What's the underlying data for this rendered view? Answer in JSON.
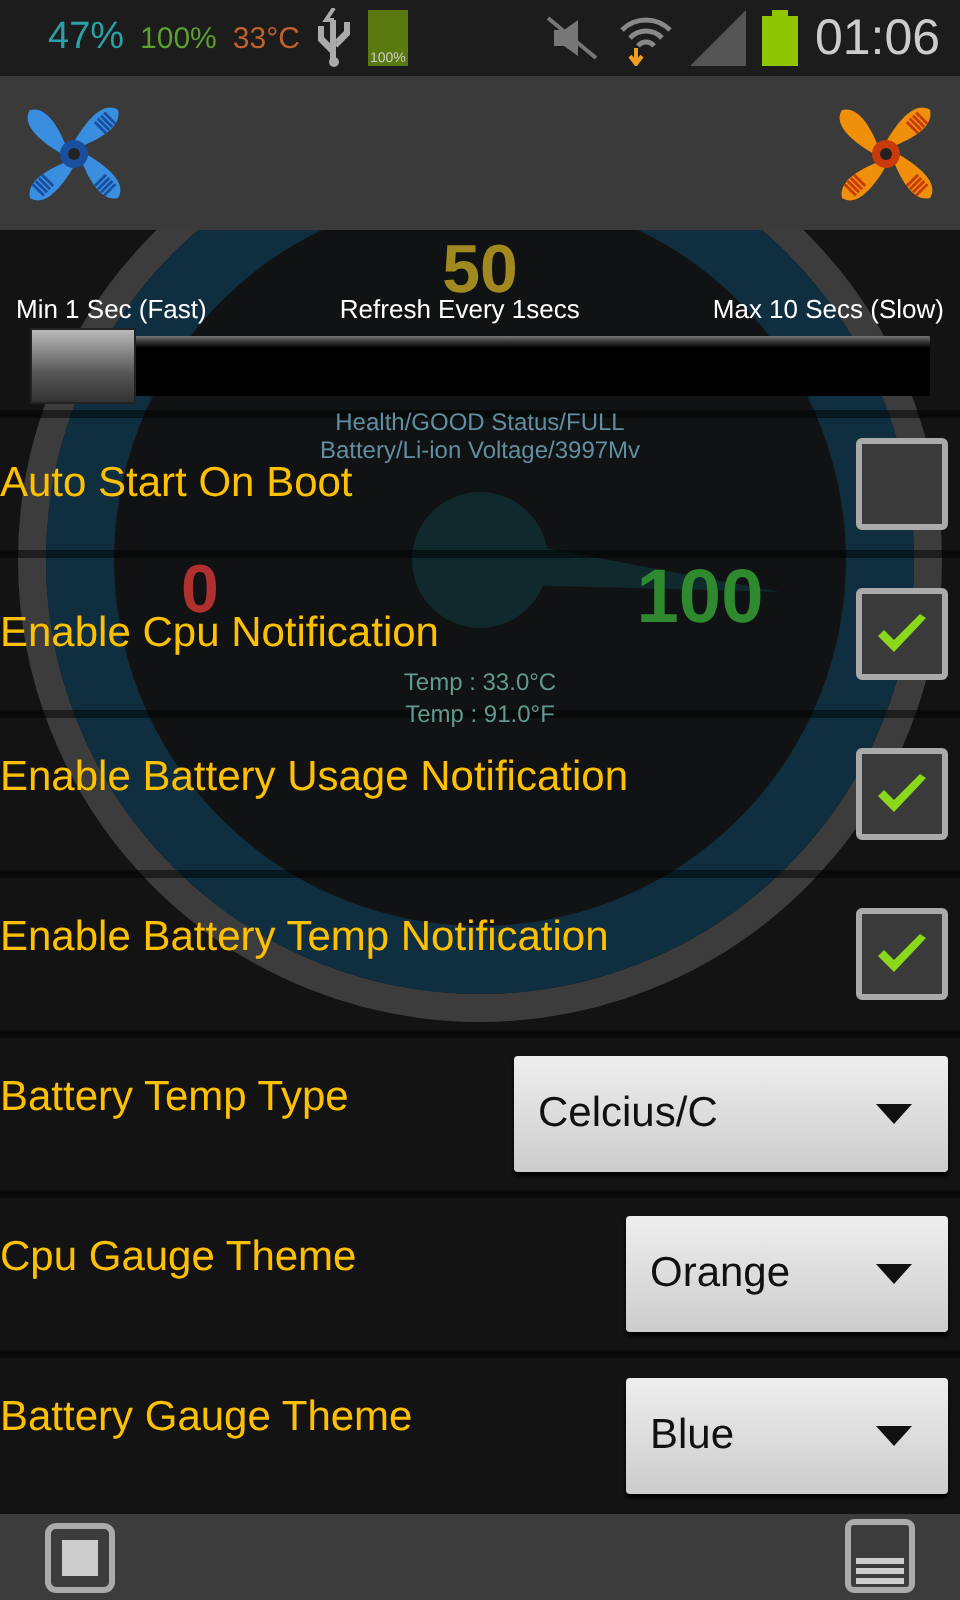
{
  "status_bar": {
    "battery_percent": "47%",
    "charge": "100%",
    "temperature": "33°C",
    "battery_icon_label": "100%",
    "time": "01:06"
  },
  "gauge": {
    "center_value": "50",
    "min_label": "0",
    "max_label": "100",
    "health": "Health/GOOD Status/FULL",
    "battery": "Battery/Li-ion Voltage/3997Mv",
    "temp_c": "Temp : 33.0°C",
    "temp_f": "Temp : 91.0°F"
  },
  "refresh": {
    "min_label": "Min 1 Sec (Fast)",
    "current_label": "Refresh Every 1secs",
    "max_label": "Max 10 Secs (Slow)",
    "level": 0
  },
  "settings": [
    {
      "kind": "checkbox",
      "label": "Auto Start On Boot",
      "checked": false
    },
    {
      "kind": "checkbox",
      "label": "Enable Cpu Notification",
      "checked": true
    },
    {
      "kind": "checkbox",
      "label": "Enable Battery Usage Notification",
      "checked": true
    },
    {
      "kind": "checkbox",
      "label": "Enable Battery Temp Notification",
      "checked": true
    },
    {
      "kind": "dropdown",
      "label": "Battery Temp Type",
      "value": "Celcius/C",
      "wide": true
    },
    {
      "kind": "dropdown",
      "label": "Cpu Gauge Theme",
      "value": "Orange",
      "wide": false
    },
    {
      "kind": "dropdown",
      "label": "Battery Gauge Theme",
      "value": "Blue",
      "wide": false
    }
  ]
}
